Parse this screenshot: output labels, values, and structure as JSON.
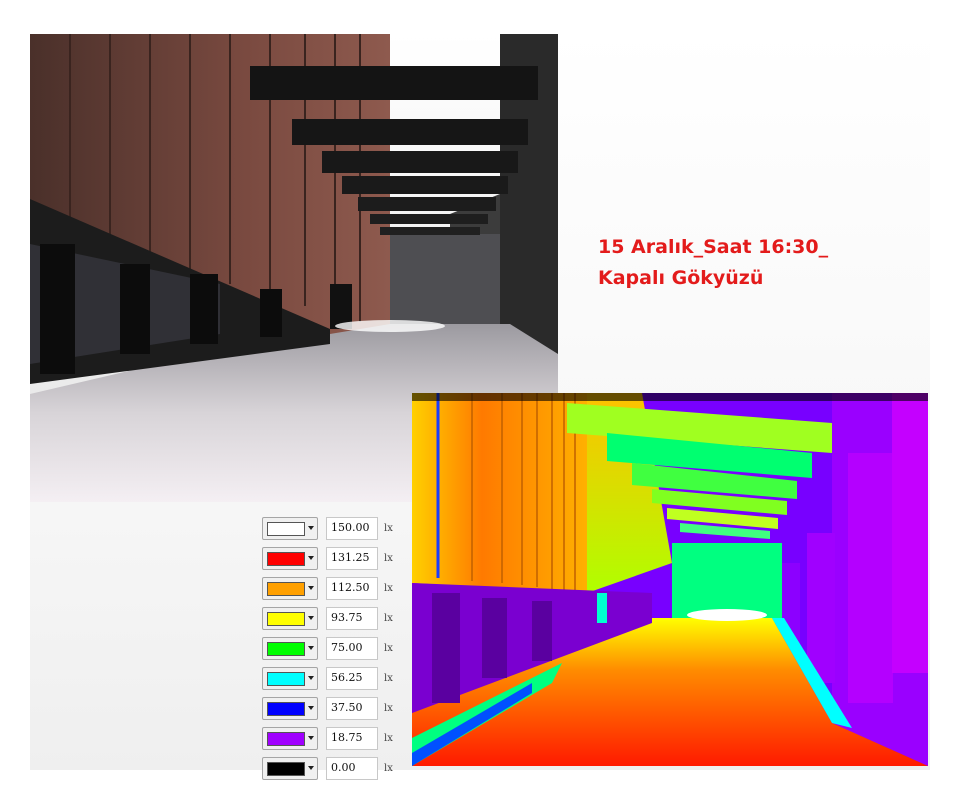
{
  "caption": {
    "line1": "15 Aralık_Saat 16:30_",
    "line2": "Kapalı Gökyüzü",
    "color": "#e31b1b"
  },
  "legend": {
    "unit": "lx",
    "items": [
      {
        "value": "150.00",
        "color": "#ffffff"
      },
      {
        "value": "131.25",
        "color": "#ff0000"
      },
      {
        "value": "112.50",
        "color": "#ffa000"
      },
      {
        "value": "93.75",
        "color": "#ffff00"
      },
      {
        "value": "75.00",
        "color": "#00ff00"
      },
      {
        "value": "56.25",
        "color": "#00ffff"
      },
      {
        "value": "37.50",
        "color": "#0000ff"
      },
      {
        "value": "18.75",
        "color": "#a000ff"
      },
      {
        "value": "0.00",
        "color": "#000000"
      }
    ]
  },
  "images": {
    "render": "realistic-render",
    "false_color": "false-color-illuminance-render"
  }
}
